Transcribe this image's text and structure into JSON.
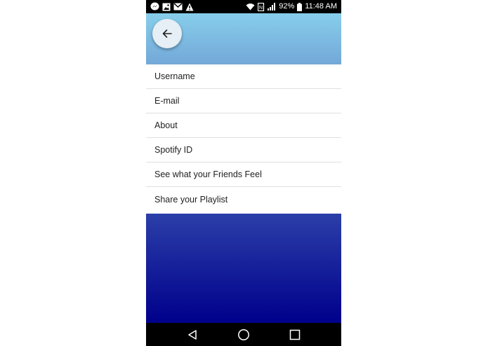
{
  "status_bar": {
    "battery": "92%",
    "time": "11:48 AM",
    "left_icons": [
      "messenger-icon",
      "image-icon",
      "gmail-icon",
      "warning-icon"
    ],
    "right_icons": [
      "wifi-icon",
      "nfc-icon",
      "signal-icon",
      "battery-icon"
    ]
  },
  "header": {
    "back_icon": "arrow-left-icon",
    "color_top": "#87ceeb",
    "color_bottom": "#73a8d8"
  },
  "menu": {
    "items": [
      {
        "label": "Username"
      },
      {
        "label": "E-mail"
      },
      {
        "label": "About"
      },
      {
        "label": "Spotify ID"
      },
      {
        "label": "See what your Friends Feel"
      },
      {
        "label": "Share your Playlist"
      }
    ]
  },
  "footer": {
    "color_top": "#2b3fa8",
    "color_bottom": "#00008b"
  },
  "nav_bar": {
    "icons": [
      "back-triangle-icon",
      "home-circle-icon",
      "recents-square-icon"
    ]
  }
}
